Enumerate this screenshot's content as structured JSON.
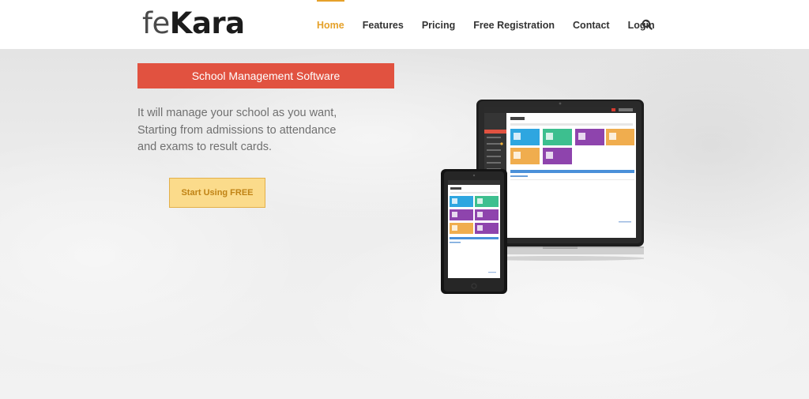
{
  "brand": {
    "part1": "fe",
    "part2": "Kara"
  },
  "nav": [
    {
      "label": "Home",
      "active": true
    },
    {
      "label": "Features"
    },
    {
      "label": "Pricing"
    },
    {
      "label": "Free Registration"
    },
    {
      "label": "Contact"
    },
    {
      "label": "Login"
    }
  ],
  "search_icon": "search-icon",
  "hero": {
    "tagline": "School Management Software",
    "description_lines": [
      "It will manage your school as you want,",
      "Starting from admissions to attendance",
      "and exams to result cards."
    ],
    "cta_label": "Start Using FREE"
  },
  "colors": {
    "accent": "#e5a12a",
    "tagline_bg": "#e15240",
    "cta_bg": "#fbdb8b",
    "cta_border": "#e3b04a",
    "cta_text": "#c08315"
  }
}
